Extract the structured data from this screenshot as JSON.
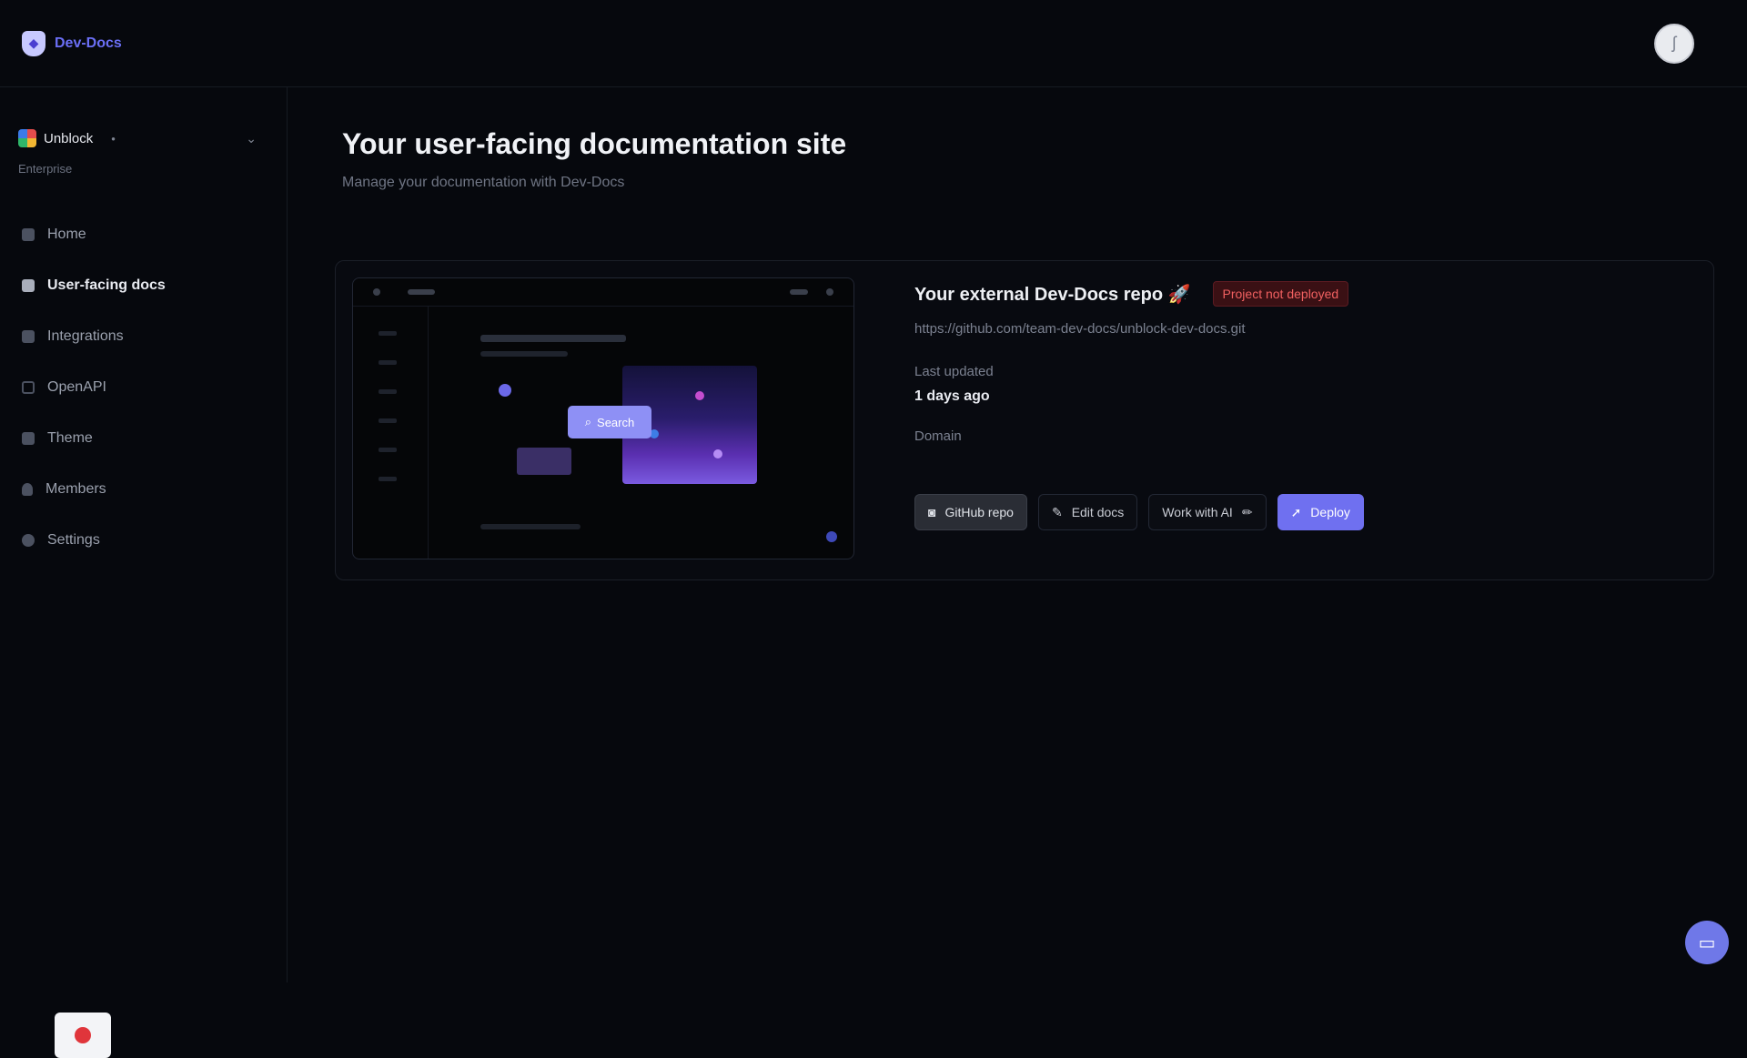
{
  "app": {
    "name": "Dev-Docs"
  },
  "header": {
    "avatar_glyph": "ʃ"
  },
  "org": {
    "name": "Unblock",
    "chip": "•",
    "sub": "Enterprise"
  },
  "sidebar": {
    "items": [
      {
        "label": "Home",
        "icon": "home-icon"
      },
      {
        "label": "User-facing docs",
        "icon": "document-icon",
        "active": true
      },
      {
        "label": "Integrations",
        "icon": "puzzle-icon"
      },
      {
        "label": "OpenAPI",
        "icon": "api-icon"
      },
      {
        "label": "Theme",
        "icon": "palette-icon"
      },
      {
        "label": "Members",
        "icon": "person-icon"
      },
      {
        "label": "Settings",
        "icon": "gear-icon"
      }
    ]
  },
  "main": {
    "title": "Your user-facing documentation site",
    "subtitle": "Manage your documentation with Dev-Docs"
  },
  "card": {
    "preview": {
      "search_label": "Search"
    },
    "repo_title": "Your external Dev-Docs repo 🚀",
    "status": "Project not deployed",
    "repo_url": "https://github.com/team-dev-docs/unblock-dev-docs.git",
    "last_updated_label": "Last updated",
    "last_updated_value": "1 days ago",
    "domain_label": "Domain",
    "actions": {
      "github": "GitHub repo",
      "edit": "Edit docs",
      "ai": "Work with AI",
      "deploy": "Deploy"
    }
  },
  "colors": {
    "accent": "#6f70f0",
    "error": "#f06060",
    "background": "#06080d"
  }
}
